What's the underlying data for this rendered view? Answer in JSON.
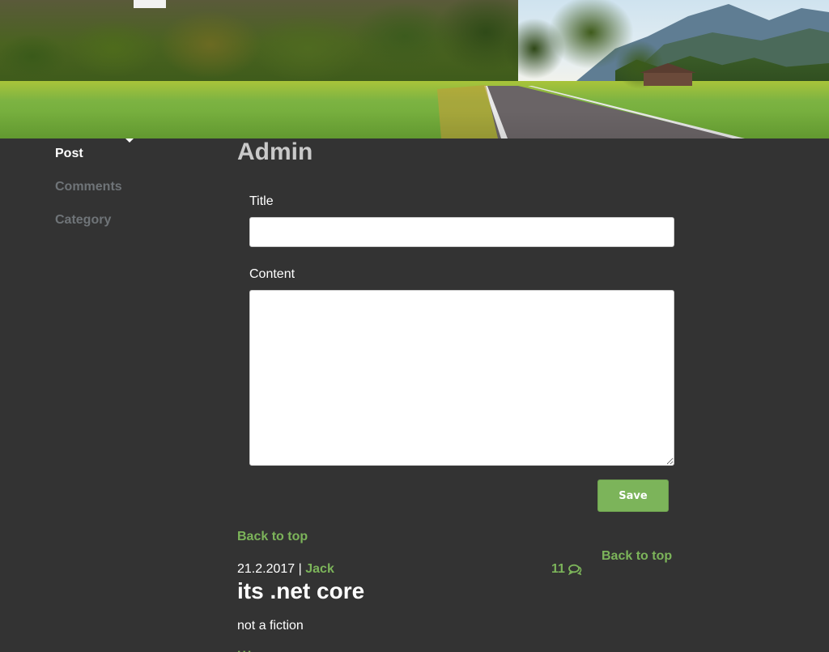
{
  "banner": {
    "image": "landscape-banner"
  },
  "sidebar": {
    "items": [
      {
        "label": "Post",
        "active": true
      },
      {
        "label": "Comments",
        "active": false
      },
      {
        "label": "Category",
        "active": false
      }
    ]
  },
  "main": {
    "title": "Admin",
    "form": {
      "title_label": "Title",
      "title_value": "",
      "content_label": "Content",
      "content_value": "",
      "save_label": "Save"
    },
    "back_to_top_label": "Back to top",
    "back_to_top_label_2": "Back to top"
  },
  "post": {
    "date": "21.2.2017",
    "separator": "|",
    "author": "Jack",
    "comment_count": "11",
    "comment_icon": "comments-icon",
    "title": "its .net core",
    "excerpt": "not a fiction",
    "read_more": "..."
  },
  "colors": {
    "background": "#333333",
    "accent": "#7cb45a",
    "title_gray": "#c9c9c9",
    "nav_inactive": "#6f7478"
  }
}
